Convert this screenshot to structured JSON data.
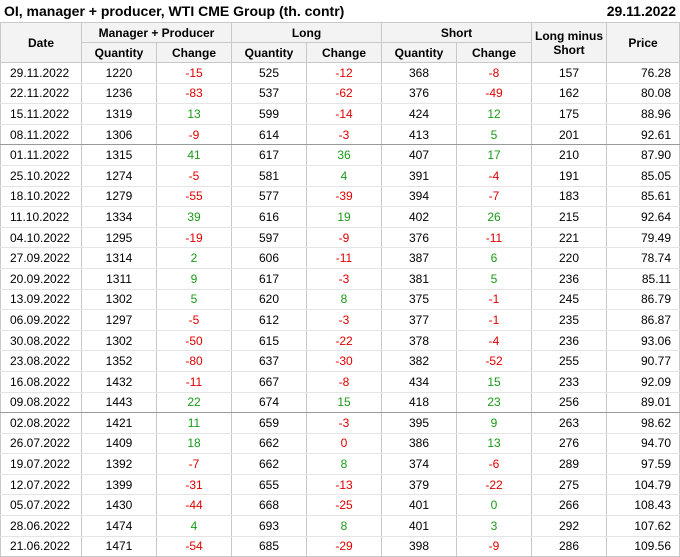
{
  "title": "OI, manager + producer, WTI CME Group (th. contr)",
  "date": "29.11.2022",
  "headers": {
    "date": "Date",
    "group_mp": "Manager + Producer",
    "group_long": "Long",
    "group_short": "Short",
    "long_minus_short": "Long minus Short",
    "price": "Price",
    "quantity": "Quantity",
    "change": "Change"
  },
  "colors": {
    "positive": "#1a9a1a",
    "negative": "#e00000",
    "header_bg": "#f3f3f3"
  },
  "rows": [
    {
      "date": "29.11.2022",
      "mp_qty": "1220",
      "mp_chg": "-15",
      "long_qty": "525",
      "long_chg": "-12",
      "short_qty": "368",
      "short_chg": "-8",
      "lms": "157",
      "price": "76.28"
    },
    {
      "date": "22.11.2022",
      "mp_qty": "1236",
      "mp_chg": "-83",
      "long_qty": "537",
      "long_chg": "-62",
      "short_qty": "376",
      "short_chg": "-49",
      "lms": "162",
      "price": "80.08"
    },
    {
      "date": "15.11.2022",
      "mp_qty": "1319",
      "mp_chg": "13",
      "long_qty": "599",
      "long_chg": "-14",
      "short_qty": "424",
      "short_chg": "12",
      "lms": "175",
      "price": "88.96"
    },
    {
      "date": "08.11.2022",
      "mp_qty": "1306",
      "mp_chg": "-9",
      "long_qty": "614",
      "long_chg": "-3",
      "short_qty": "413",
      "short_chg": "5",
      "lms": "201",
      "price": "92.61"
    },
    {
      "date": "01.11.2022",
      "mp_qty": "1315",
      "mp_chg": "41",
      "long_qty": "617",
      "long_chg": "36",
      "short_qty": "407",
      "short_chg": "17",
      "lms": "210",
      "price": "87.90"
    },
    {
      "date": "25.10.2022",
      "mp_qty": "1274",
      "mp_chg": "-5",
      "long_qty": "581",
      "long_chg": "4",
      "short_qty": "391",
      "short_chg": "-4",
      "lms": "191",
      "price": "85.05"
    },
    {
      "date": "18.10.2022",
      "mp_qty": "1279",
      "mp_chg": "-55",
      "long_qty": "577",
      "long_chg": "-39",
      "short_qty": "394",
      "short_chg": "-7",
      "lms": "183",
      "price": "85.61"
    },
    {
      "date": "11.10.2022",
      "mp_qty": "1334",
      "mp_chg": "39",
      "long_qty": "616",
      "long_chg": "19",
      "short_qty": "402",
      "short_chg": "26",
      "lms": "215",
      "price": "92.64"
    },
    {
      "date": "04.10.2022",
      "mp_qty": "1295",
      "mp_chg": "-19",
      "long_qty": "597",
      "long_chg": "-9",
      "short_qty": "376",
      "short_chg": "-11",
      "lms": "221",
      "price": "79.49"
    },
    {
      "date": "27.09.2022",
      "mp_qty": "1314",
      "mp_chg": "2",
      "long_qty": "606",
      "long_chg": "-11",
      "short_qty": "387",
      "short_chg": "6",
      "lms": "220",
      "price": "78.74"
    },
    {
      "date": "20.09.2022",
      "mp_qty": "1311",
      "mp_chg": "9",
      "long_qty": "617",
      "long_chg": "-3",
      "short_qty": "381",
      "short_chg": "5",
      "lms": "236",
      "price": "85.11"
    },
    {
      "date": "13.09.2022",
      "mp_qty": "1302",
      "mp_chg": "5",
      "long_qty": "620",
      "long_chg": "8",
      "short_qty": "375",
      "short_chg": "-1",
      "lms": "245",
      "price": "86.79"
    },
    {
      "date": "06.09.2022",
      "mp_qty": "1297",
      "mp_chg": "-5",
      "long_qty": "612",
      "long_chg": "-3",
      "short_qty": "377",
      "short_chg": "-1",
      "lms": "235",
      "price": "86.87"
    },
    {
      "date": "30.08.2022",
      "mp_qty": "1302",
      "mp_chg": "-50",
      "long_qty": "615",
      "long_chg": "-22",
      "short_qty": "378",
      "short_chg": "-4",
      "lms": "236",
      "price": "93.06"
    },
    {
      "date": "23.08.2022",
      "mp_qty": "1352",
      "mp_chg": "-80",
      "long_qty": "637",
      "long_chg": "-30",
      "short_qty": "382",
      "short_chg": "-52",
      "lms": "255",
      "price": "90.77"
    },
    {
      "date": "16.08.2022",
      "mp_qty": "1432",
      "mp_chg": "-11",
      "long_qty": "667",
      "long_chg": "-8",
      "short_qty": "434",
      "short_chg": "15",
      "lms": "233",
      "price": "92.09"
    },
    {
      "date": "09.08.2022",
      "mp_qty": "1443",
      "mp_chg": "22",
      "long_qty": "674",
      "long_chg": "15",
      "short_qty": "418",
      "short_chg": "23",
      "lms": "256",
      "price": "89.01"
    },
    {
      "date": "02.08.2022",
      "mp_qty": "1421",
      "mp_chg": "11",
      "long_qty": "659",
      "long_chg": "-3",
      "short_qty": "395",
      "short_chg": "9",
      "lms": "263",
      "price": "98.62"
    },
    {
      "date": "26.07.2022",
      "mp_qty": "1409",
      "mp_chg": "18",
      "long_qty": "662",
      "long_chg": "0",
      "short_qty": "386",
      "short_chg": "13",
      "lms": "276",
      "price": "94.70"
    },
    {
      "date": "19.07.2022",
      "mp_qty": "1392",
      "mp_chg": "-7",
      "long_qty": "662",
      "long_chg": "8",
      "short_qty": "374",
      "short_chg": "-6",
      "lms": "289",
      "price": "97.59"
    },
    {
      "date": "12.07.2022",
      "mp_qty": "1399",
      "mp_chg": "-31",
      "long_qty": "655",
      "long_chg": "-13",
      "short_qty": "379",
      "short_chg": "-22",
      "lms": "275",
      "price": "104.79"
    },
    {
      "date": "05.07.2022",
      "mp_qty": "1430",
      "mp_chg": "-44",
      "long_qty": "668",
      "long_chg": "-25",
      "short_qty": "401",
      "short_chg": "0",
      "lms": "266",
      "price": "108.43"
    },
    {
      "date": "28.06.2022",
      "mp_qty": "1474",
      "mp_chg": "4",
      "long_qty": "693",
      "long_chg": "8",
      "short_qty": "401",
      "short_chg": "3",
      "lms": "292",
      "price": "107.62"
    },
    {
      "date": "21.06.2022",
      "mp_qty": "1471",
      "mp_chg": "-54",
      "long_qty": "685",
      "long_chg": "-29",
      "short_qty": "398",
      "short_chg": "-9",
      "lms": "286",
      "price": "109.56"
    }
  ]
}
